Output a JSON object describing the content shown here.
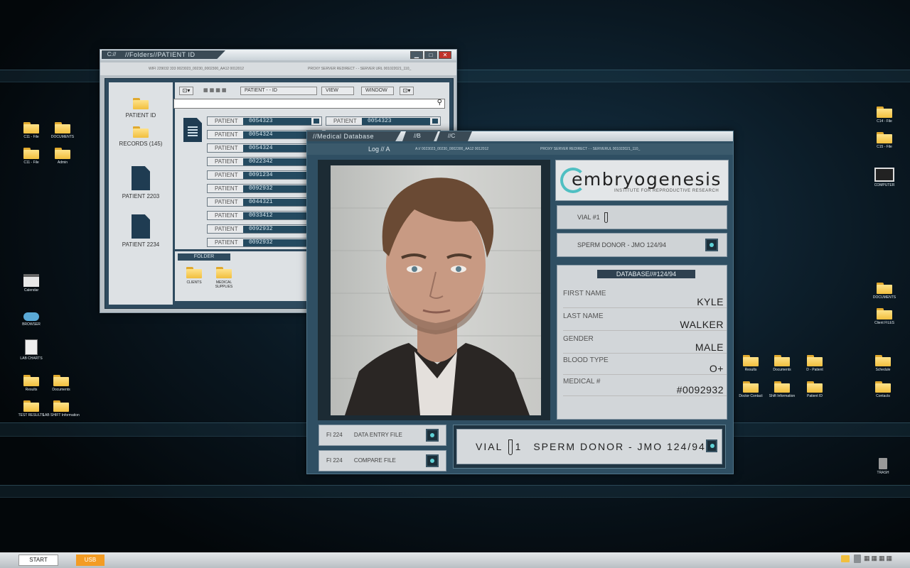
{
  "desktop_icons": [
    {
      "id": "c11-file-1",
      "label": "C11 - File",
      "type": "folder"
    },
    {
      "id": "documents-l",
      "label": "DOCUMENTS",
      "type": "folder"
    },
    {
      "id": "c11-file-2",
      "label": "C11 - File",
      "type": "folder"
    },
    {
      "id": "admin",
      "label": "Admin",
      "type": "folder"
    },
    {
      "id": "calendar",
      "label": "Calendar",
      "type": "calendar"
    },
    {
      "id": "browser",
      "label": "BROWSER",
      "type": "cloud"
    },
    {
      "id": "lab-charts",
      "label": "LAB CHARTS",
      "type": "chart"
    },
    {
      "id": "results-l",
      "label": "Results",
      "type": "folder"
    },
    {
      "id": "documents-l2",
      "label": "Documents",
      "type": "folder"
    },
    {
      "id": "test-results",
      "label": "TEST RESULTS",
      "type": "folder"
    },
    {
      "id": "lab-shift",
      "label": "LAB SHIFT Information",
      "type": "folder"
    },
    {
      "id": "c14-file",
      "label": "C14 - File",
      "type": "folder"
    },
    {
      "id": "c15-file",
      "label": "C15 - File",
      "type": "folder"
    },
    {
      "id": "computer",
      "label": "COMPUTER",
      "type": "monitor"
    },
    {
      "id": "documents-r",
      "label": "DOCUMENTS",
      "type": "folder"
    },
    {
      "id": "client-files",
      "label": "Client FILES",
      "type": "folder"
    },
    {
      "id": "results-r",
      "label": "Results",
      "type": "folder"
    },
    {
      "id": "documents-r2",
      "label": "Documents",
      "type": "folder"
    },
    {
      "id": "d-patient",
      "label": "D - Patient",
      "type": "folder"
    },
    {
      "id": "schedule",
      "label": "Schedule",
      "type": "folder"
    },
    {
      "id": "doctor-contact",
      "label": "Doctor Contact",
      "type": "folder"
    },
    {
      "id": "shift-information",
      "label": "Shift Information",
      "type": "folder"
    },
    {
      "id": "patient-id-r",
      "label": "Patient ID",
      "type": "folder"
    },
    {
      "id": "contacts",
      "label": "Contacts",
      "type": "folder"
    },
    {
      "id": "trash",
      "label": "TRASH",
      "type": "trash"
    }
  ],
  "folders_window": {
    "title_prefix": "C://",
    "title": "//Folders//PATIENT ID",
    "info_left": "WIFI 229032 333  0023023_00230_0002300_AA12  0012012",
    "info_right": "PROXY SERVER REDIRECT  - -  SERVER URL 001022021_110_",
    "dropdowns": [
      "PATIENT  - -  ID",
      "VIEW",
      "WINDOW"
    ],
    "sidebar": [
      {
        "label": "PATIENT ID",
        "icon": "folder-icon"
      },
      {
        "label": "RECORDS (145)",
        "icon": "folder-icon"
      },
      {
        "label": "PATIENT 2203",
        "icon": "document-icon"
      },
      {
        "label": "PATIENT 2234",
        "icon": "document-icon"
      }
    ],
    "row_label": "PATIENT",
    "rows": [
      "0054323",
      "0054324",
      "0054324",
      "0022342",
      "0091234",
      "0092932",
      "0044321",
      "0033412",
      "0092932",
      "0092932"
    ],
    "rows_col2": [
      "0054323",
      "0054324"
    ],
    "folder_tab": "FOLDER",
    "folder_items": [
      "CLIENTS",
      "MEDICAL SUPPLIES"
    ]
  },
  "medical_window": {
    "tabs": [
      "//Medical Database",
      "//B",
      "//C"
    ],
    "log_label": "Log // A",
    "info_left": "A://  0023023_00230_0002300_AA12  0012012",
    "info_right": "PROXY SERVER REDIRECT  - -  SERVERUL 001022021_110_",
    "logo_name": "embryogenesis",
    "logo_tagline": "INSTITUTE FOR REPRODUCTIVE RESEARCH",
    "vial": "VIAL #1",
    "donor": "SPERM DONOR - JMO 124/94",
    "database_header": "DATABASE//#124/94",
    "fields": [
      {
        "key": "FIRST NAME",
        "value": "KYLE"
      },
      {
        "key": "LAST NAME",
        "value": "WALKER"
      },
      {
        "key": "GENDER",
        "value": "MALE"
      },
      {
        "key": "BLOOD TYPE",
        "value": "O+"
      },
      {
        "key": "MEDICAL #",
        "value": "#0092932"
      }
    ],
    "buttons": [
      {
        "code": "FI 224",
        "label": "DATA ENTRY FILE"
      },
      {
        "code": "FI 224",
        "label": "COMPARE FILE"
      }
    ],
    "banner_vial": "VIAL",
    "banner_num": "1",
    "banner_text": "SPERM DONOR - JMO 124/94"
  },
  "taskbar": {
    "start": "START",
    "usb": "USB"
  }
}
